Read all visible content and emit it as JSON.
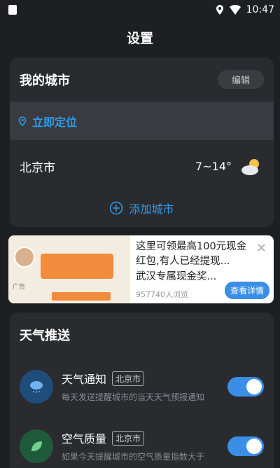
{
  "status": {
    "time": "10:47"
  },
  "header": {
    "title": "设置"
  },
  "cities": {
    "title": "我的城市",
    "edit_label": "编辑",
    "locate_label": "立即定位",
    "items": [
      {
        "name": "北京市",
        "temp": "7~14°"
      }
    ],
    "add_label": "添加城市"
  },
  "ad": {
    "title": "这里可领最高100元现金红包,有人已经提现...",
    "subtitle": "武汉专属现金奖...",
    "views": "957740人浏览",
    "cta": "查看详情",
    "badge": "广告"
  },
  "push": {
    "title": "天气推送",
    "items": [
      {
        "name": "天气通知",
        "city": "北京市",
        "desc": "每天发送提醒城市的当天天气预报通知"
      },
      {
        "name": "空气质量",
        "city": "北京市",
        "desc": "如果今天提醒城市的空气质量指数大于"
      }
    ]
  },
  "colors": {
    "accent": "#2f9be6",
    "toggle": "#3a8ee6"
  }
}
